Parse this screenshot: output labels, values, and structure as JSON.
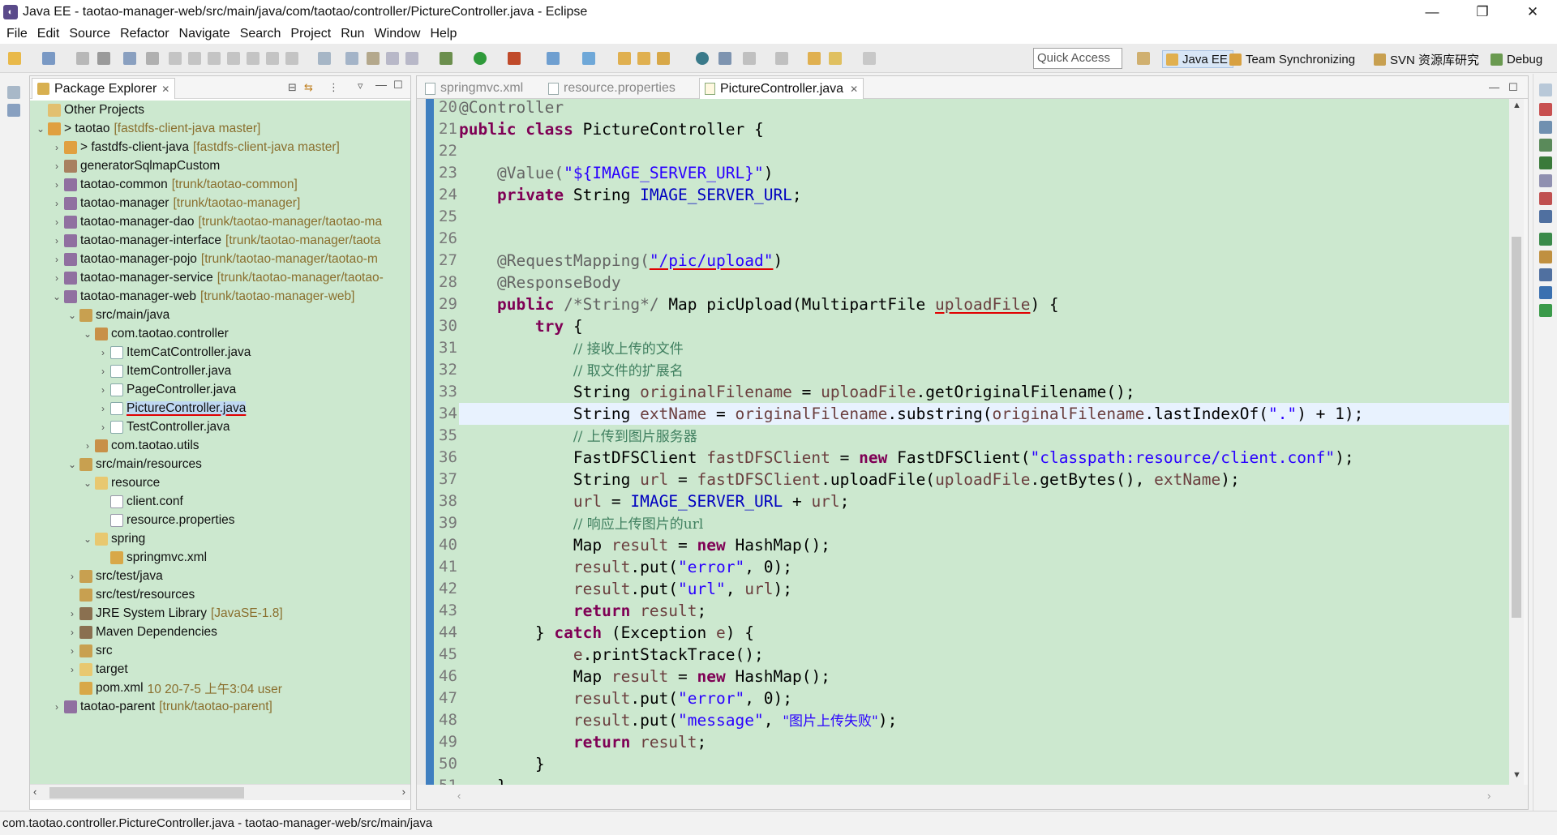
{
  "window": {
    "title": "Java EE - taotao-manager-web/src/main/java/com/taotao/controller/PictureController.java - Eclipse",
    "minimize": "—",
    "restore": "❐",
    "close": "✕"
  },
  "menu": [
    "File",
    "Edit",
    "Source",
    "Refactor",
    "Navigate",
    "Search",
    "Project",
    "Run",
    "Window",
    "Help"
  ],
  "toolbar": {
    "quick_access_placeholder": "Quick Access",
    "perspectives": [
      "Java EE",
      "Team Synchronizing",
      "SVN 资源库研究",
      "Debug"
    ]
  },
  "package_explorer": {
    "title": "Package Explorer",
    "tree": [
      {
        "arrow": "",
        "label": "Other Projects",
        "deco": ""
      },
      {
        "arrow": "⌄",
        "label": "> taotao",
        "deco": "[fastdfs-client-java master]"
      },
      {
        "arrow": "›",
        "label": "> fastdfs-client-java",
        "deco": "[fastdfs-client-java master]"
      },
      {
        "arrow": "›",
        "label": "generatorSqlmapCustom",
        "deco": ""
      },
      {
        "arrow": "›",
        "label": "taotao-common",
        "deco": "[trunk/taotao-common]"
      },
      {
        "arrow": "›",
        "label": "taotao-manager",
        "deco": "[trunk/taotao-manager]"
      },
      {
        "arrow": "›",
        "label": "taotao-manager-dao",
        "deco": "[trunk/taotao-manager/taotao-ma"
      },
      {
        "arrow": "›",
        "label": "taotao-manager-interface",
        "deco": "[trunk/taotao-manager/taota"
      },
      {
        "arrow": "›",
        "label": "taotao-manager-pojo",
        "deco": "[trunk/taotao-manager/taotao-m"
      },
      {
        "arrow": "›",
        "label": "taotao-manager-service",
        "deco": "[trunk/taotao-manager/taotao-"
      },
      {
        "arrow": "⌄",
        "label": "taotao-manager-web",
        "deco": "[trunk/taotao-manager-web]"
      },
      {
        "arrow": "⌄",
        "label": "src/main/java",
        "deco": ""
      },
      {
        "arrow": "⌄",
        "label": "com.taotao.controller",
        "deco": ""
      },
      {
        "arrow": "›",
        "label": "ItemCatController.java",
        "deco": ""
      },
      {
        "arrow": "›",
        "label": "ItemController.java",
        "deco": ""
      },
      {
        "arrow": "›",
        "label": "PageController.java",
        "deco": ""
      },
      {
        "arrow": "›",
        "label": "PictureController.java",
        "deco": ""
      },
      {
        "arrow": "›",
        "label": "TestController.java",
        "deco": ""
      },
      {
        "arrow": "›",
        "label": "com.taotao.utils",
        "deco": ""
      },
      {
        "arrow": "⌄",
        "label": "src/main/resources",
        "deco": ""
      },
      {
        "arrow": "⌄",
        "label": "resource",
        "deco": ""
      },
      {
        "arrow": "",
        "label": "client.conf",
        "deco": ""
      },
      {
        "arrow": "",
        "label": "resource.properties",
        "deco": ""
      },
      {
        "arrow": "⌄",
        "label": "spring",
        "deco": ""
      },
      {
        "arrow": "",
        "label": "springmvc.xml",
        "deco": ""
      },
      {
        "arrow": "›",
        "label": "src/test/java",
        "deco": ""
      },
      {
        "arrow": "",
        "label": "src/test/resources",
        "deco": ""
      },
      {
        "arrow": "›",
        "label": "JRE System Library",
        "deco": "[JavaSE-1.8]"
      },
      {
        "arrow": "›",
        "label": "Maven Dependencies",
        "deco": ""
      },
      {
        "arrow": "›",
        "label": "src",
        "deco": ""
      },
      {
        "arrow": "›",
        "label": "target",
        "deco": ""
      },
      {
        "arrow": "",
        "label": "pom.xml",
        "deco": "10  20-7-5 上午3:04  user"
      },
      {
        "arrow": "›",
        "label": "taotao-parent",
        "deco": "[trunk/taotao-parent]"
      }
    ]
  },
  "editor": {
    "tabs": [
      "springmvc.xml",
      "resource.properties",
      "PictureController.java"
    ],
    "active_tab": "PictureController.java",
    "line_numbers": [
      "20",
      "21",
      "22",
      "23",
      "24",
      "25",
      "26",
      "27",
      "28",
      "29",
      "30",
      "31",
      "32",
      "33",
      "34",
      "35",
      "36",
      "37",
      "38",
      "39",
      "40",
      "41",
      "42",
      "43",
      "44",
      "45",
      "46",
      "47",
      "48",
      "49",
      "50",
      "51"
    ],
    "code": {
      "l20_ann": "@Controller",
      "l21_kw1": "public",
      "l21_kw2": "class",
      "l21_rest": " PictureController {",
      "l23_ann": "@Value(",
      "l23_str": "\"${IMAGE_SERVER_URL}\"",
      "l23_end": ")",
      "l24_kw": "private",
      "l24_type": " String ",
      "l24_fld": "IMAGE_SERVER_URL",
      "l24_end": ";",
      "l27_ann": "@RequestMapping(",
      "l27_str": "\"/pic/upload\"",
      "l27_end": ")",
      "l28_ann": "@ResponseBody",
      "l29_kw": "public",
      "l29_cm": "/*String*/",
      "l29_mid": " Map picUpload(MultipartFile ",
      "l29_param": "uploadFile",
      "l29_end": ") {",
      "l30_kw": "try",
      "l30_end": " {",
      "l31_cm": "// 接收上传的文件",
      "l32_cm": "// 取文件的扩展名",
      "l33_a": "String ",
      "l33_loc": "originalFilename",
      "l33_b": " = ",
      "l33_loc2": "uploadFile",
      "l33_c": ".getOriginalFilename();",
      "l34_a": "String ",
      "l34_loc": "extName",
      "l34_b": " = ",
      "l34_loc2": "originalFilename",
      "l34_c": ".substring(",
      "l34_loc3": "originalFilename",
      "l34_d": ".lastIndexOf(",
      "l34_str": "\".\"",
      "l34_e": ") + 1);",
      "l35_cm": "// 上传到图片服务器",
      "l36_a": "FastDFSClient ",
      "l36_loc": "fastDFSClient",
      "l36_b": " = ",
      "l36_kw": "new",
      "l36_c": " FastDFSClient(",
      "l36_str": "\"classpath:resource/client.conf\"",
      "l36_d": ");",
      "l37_a": "String ",
      "l37_loc": "url",
      "l37_b": " = ",
      "l37_loc2": "fastDFSClient",
      "l37_c": ".uploadFile(",
      "l37_loc3": "uploadFile",
      "l37_d": ".getBytes(), ",
      "l37_loc4": "extName",
      "l37_e": ");",
      "l38_loc": "url",
      "l38_a": " = ",
      "l38_fld": "IMAGE_SERVER_URL",
      "l38_b": " + ",
      "l38_loc2": "url",
      "l38_c": ";",
      "l39_cm": "// 响应上传图片的url",
      "l40_a": "Map ",
      "l40_loc": "result",
      "l40_b": " = ",
      "l40_kw": "new",
      "l40_c": " HashMap();",
      "l41_loc": "result",
      "l41_a": ".put(",
      "l41_str": "\"error\"",
      "l41_b": ", 0);",
      "l42_loc": "result",
      "l42_a": ".put(",
      "l42_str": "\"url\"",
      "l42_b": ", ",
      "l42_loc2": "url",
      "l42_c": ");",
      "l43_kw": "return",
      "l43_loc": " result",
      "l43_end": ";",
      "l44_a": "} ",
      "l44_kw": "catch",
      "l44_b": " (Exception ",
      "l44_loc": "e",
      "l44_c": ") {",
      "l45_loc": "e",
      "l45_a": ".printStackTrace();",
      "l46_a": "Map ",
      "l46_loc": "result",
      "l46_b": " = ",
      "l46_kw": "new",
      "l46_c": " HashMap();",
      "l47_loc": "result",
      "l47_a": ".put(",
      "l47_str": "\"error\"",
      "l47_b": ", 0);",
      "l48_loc": "result",
      "l48_a": ".put(",
      "l48_str": "\"message\"",
      "l48_b": ", ",
      "l48_str2": "\"图片上传失败\"",
      "l48_c": ");",
      "l49_kw": "return",
      "l49_loc": " result",
      "l49_end": ";",
      "l50": "}",
      "l51": "}"
    }
  },
  "status": {
    "text": "com.taotao.controller.PictureController.java - taotao-manager-web/src/main/java"
  }
}
